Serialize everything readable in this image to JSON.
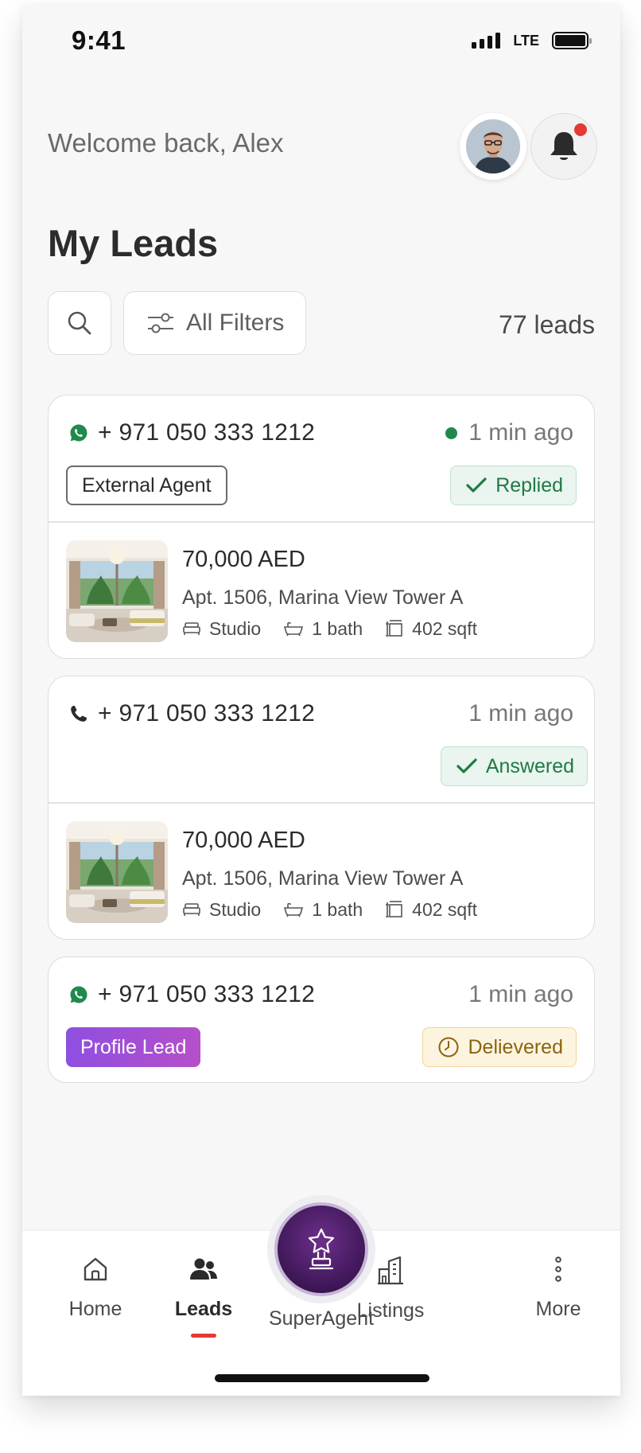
{
  "status_bar": {
    "time": "9:41",
    "network": "LTE"
  },
  "header": {
    "welcome": "Welcome back, Alex"
  },
  "page": {
    "title": "My Leads"
  },
  "toolbar": {
    "filters_label": "All Filters",
    "lead_count": "77 leads"
  },
  "leads": [
    {
      "channel": "whatsapp",
      "phone": "+ 971 050 333 1212",
      "time": "1 min ago",
      "online": true,
      "tag": "External Agent",
      "status": "Replied",
      "property": {
        "price": "70,000 AED",
        "address": "Apt. 1506, Marina View Tower A",
        "beds": "Studio",
        "baths": "1 bath",
        "size": "402 sqft"
      }
    },
    {
      "channel": "call",
      "phone": "+ 971 050 333 1212",
      "time": "1 min ago",
      "online": false,
      "tag": "",
      "status": "Answered",
      "property": {
        "price": "70,000 AED",
        "address": "Apt. 1506, Marina View Tower A",
        "beds": "Studio",
        "baths": "1 bath",
        "size": "402 sqft"
      }
    },
    {
      "channel": "whatsapp",
      "phone": "+ 971 050 333 1212",
      "time": "1 min ago",
      "online": false,
      "tag": "Profile Lead",
      "status": "Delievered"
    }
  ],
  "nav": {
    "home": "Home",
    "leads": "Leads",
    "superagent": "SuperAgent",
    "listings": "Listings",
    "more": "More",
    "active": "leads"
  },
  "colors": {
    "accent_red": "#e53935",
    "success_green": "#1f7a45",
    "whatsapp_green": "#1f8a4c",
    "delivered_amber": "#8a6410",
    "superagent_purple": "#3a1552"
  },
  "icons": [
    "search-icon",
    "filter-sliders-icon",
    "whatsapp-icon",
    "phone-icon",
    "check-icon",
    "clock-icon",
    "bed-icon",
    "bath-icon",
    "area-icon",
    "bell-icon",
    "home-icon",
    "users-icon",
    "trophy-icon",
    "building-icon",
    "more-vertical-icon"
  ]
}
